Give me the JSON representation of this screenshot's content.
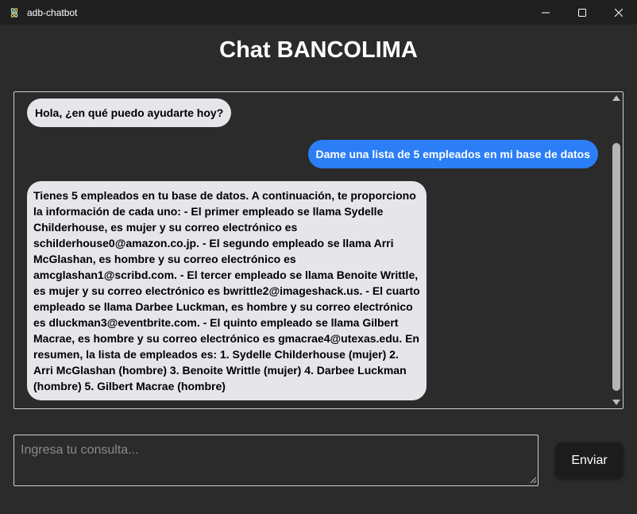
{
  "window": {
    "title": "adb-chatbot",
    "app_icon": "electron-icon",
    "controls": [
      "minimize-icon",
      "maximize-icon",
      "close-icon"
    ]
  },
  "page": {
    "title": "Chat BANCOLIMA"
  },
  "chat": {
    "messages": [
      {
        "role": "bot",
        "text": "Hola, ¿en qué puedo ayudarte hoy?"
      },
      {
        "role": "user",
        "text": "Dame una lista de 5 empleados en mi base de datos"
      },
      {
        "role": "bot",
        "text": "Tienes 5 empleados en tu base de datos. A continuación, te proporciono la información de cada uno: - El primer empleado se llama Sydelle Childerhouse, es mujer y su correo electrónico es schilderhouse0@amazon.co.jp. - El segundo empleado se llama Arri McGlashan, es hombre y su correo electrónico es amcglashan1@scribd.com. - El tercer empleado se llama Benoite Writtle, es mujer y su correo electrónico es bwrittle2@imageshack.us. - El cuarto empleado se llama Darbee Luckman, es hombre y su correo electrónico es dluckman3@eventbrite.com. - El quinto empleado se llama Gilbert Macrae, es hombre y su correo electrónico es gmacrae4@utexas.edu. En resumen, la lista de empleados es: 1. Sydelle Childerhouse (mujer) 2. Arri McGlashan (hombre) 3. Benoite Writtle (mujer) 4. Darbee Luckman (hombre) 5. Gilbert Macrae (hombre)"
      }
    ]
  },
  "input": {
    "placeholder": "Ingresa tu consulta...",
    "value": ""
  },
  "send_button": {
    "label": "Enviar"
  },
  "colors": {
    "background": "#2b2b2b",
    "titlebar": "#202020",
    "bot_bubble": "#e5e5ea",
    "user_bubble": "#2b7ef6",
    "button": "#1c1c1c"
  }
}
